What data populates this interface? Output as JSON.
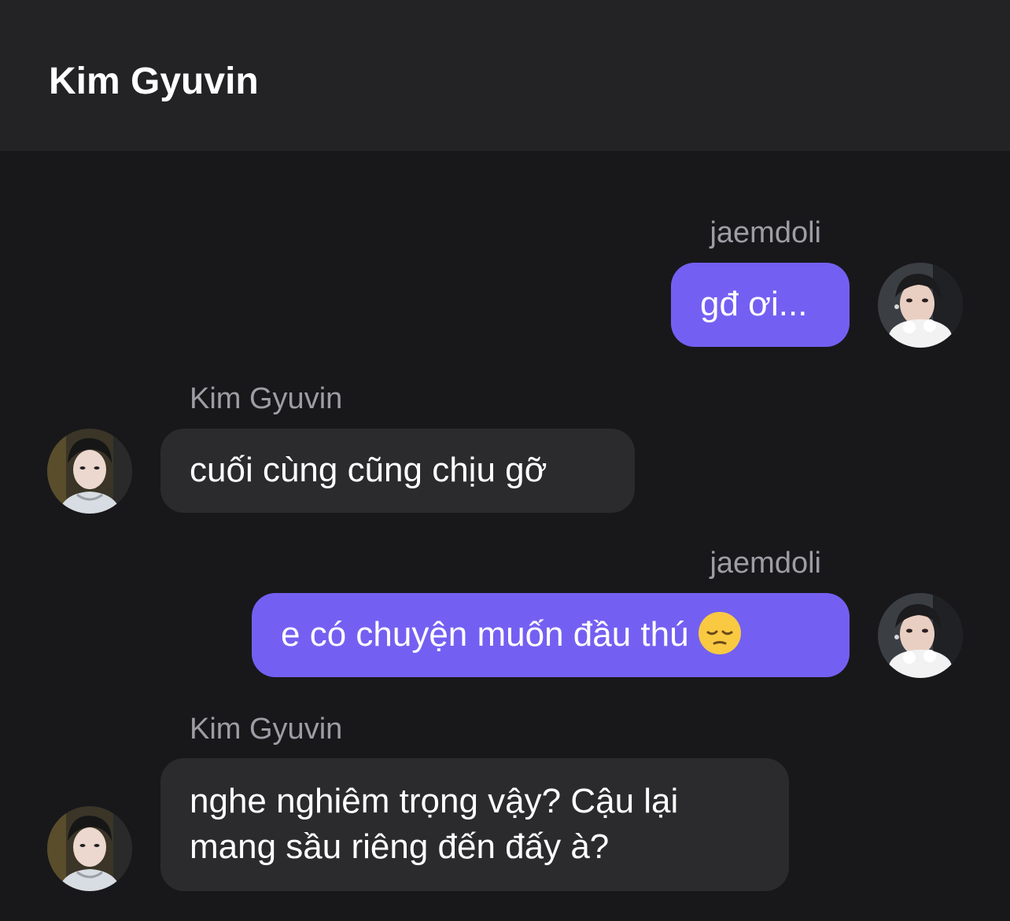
{
  "header": {
    "title": "Kim Gyuvin"
  },
  "messages": [
    {
      "sender": "jaemdoli",
      "direction": "sent",
      "text": "gđ ơi..."
    },
    {
      "sender": "Kim Gyuvin",
      "direction": "received",
      "text": "cuối cùng cũng chịu gỡ"
    },
    {
      "sender": "jaemdoli",
      "direction": "sent",
      "text": "e có chuyện muốn đầu thú",
      "emoji": "pensive-face-emoji"
    },
    {
      "sender": "Kim Gyuvin",
      "direction": "received",
      "lines": [
        "nghe nghiêm trọng vậy? Cậu lại",
        "mang sầu riêng đến đấy à?"
      ]
    }
  ],
  "colors": {
    "background": "#18181b",
    "header": "#232326",
    "sent_bubble": "#7360f2",
    "received_bubble": "#2b2b2e",
    "sender_name": "#9d9da3"
  }
}
